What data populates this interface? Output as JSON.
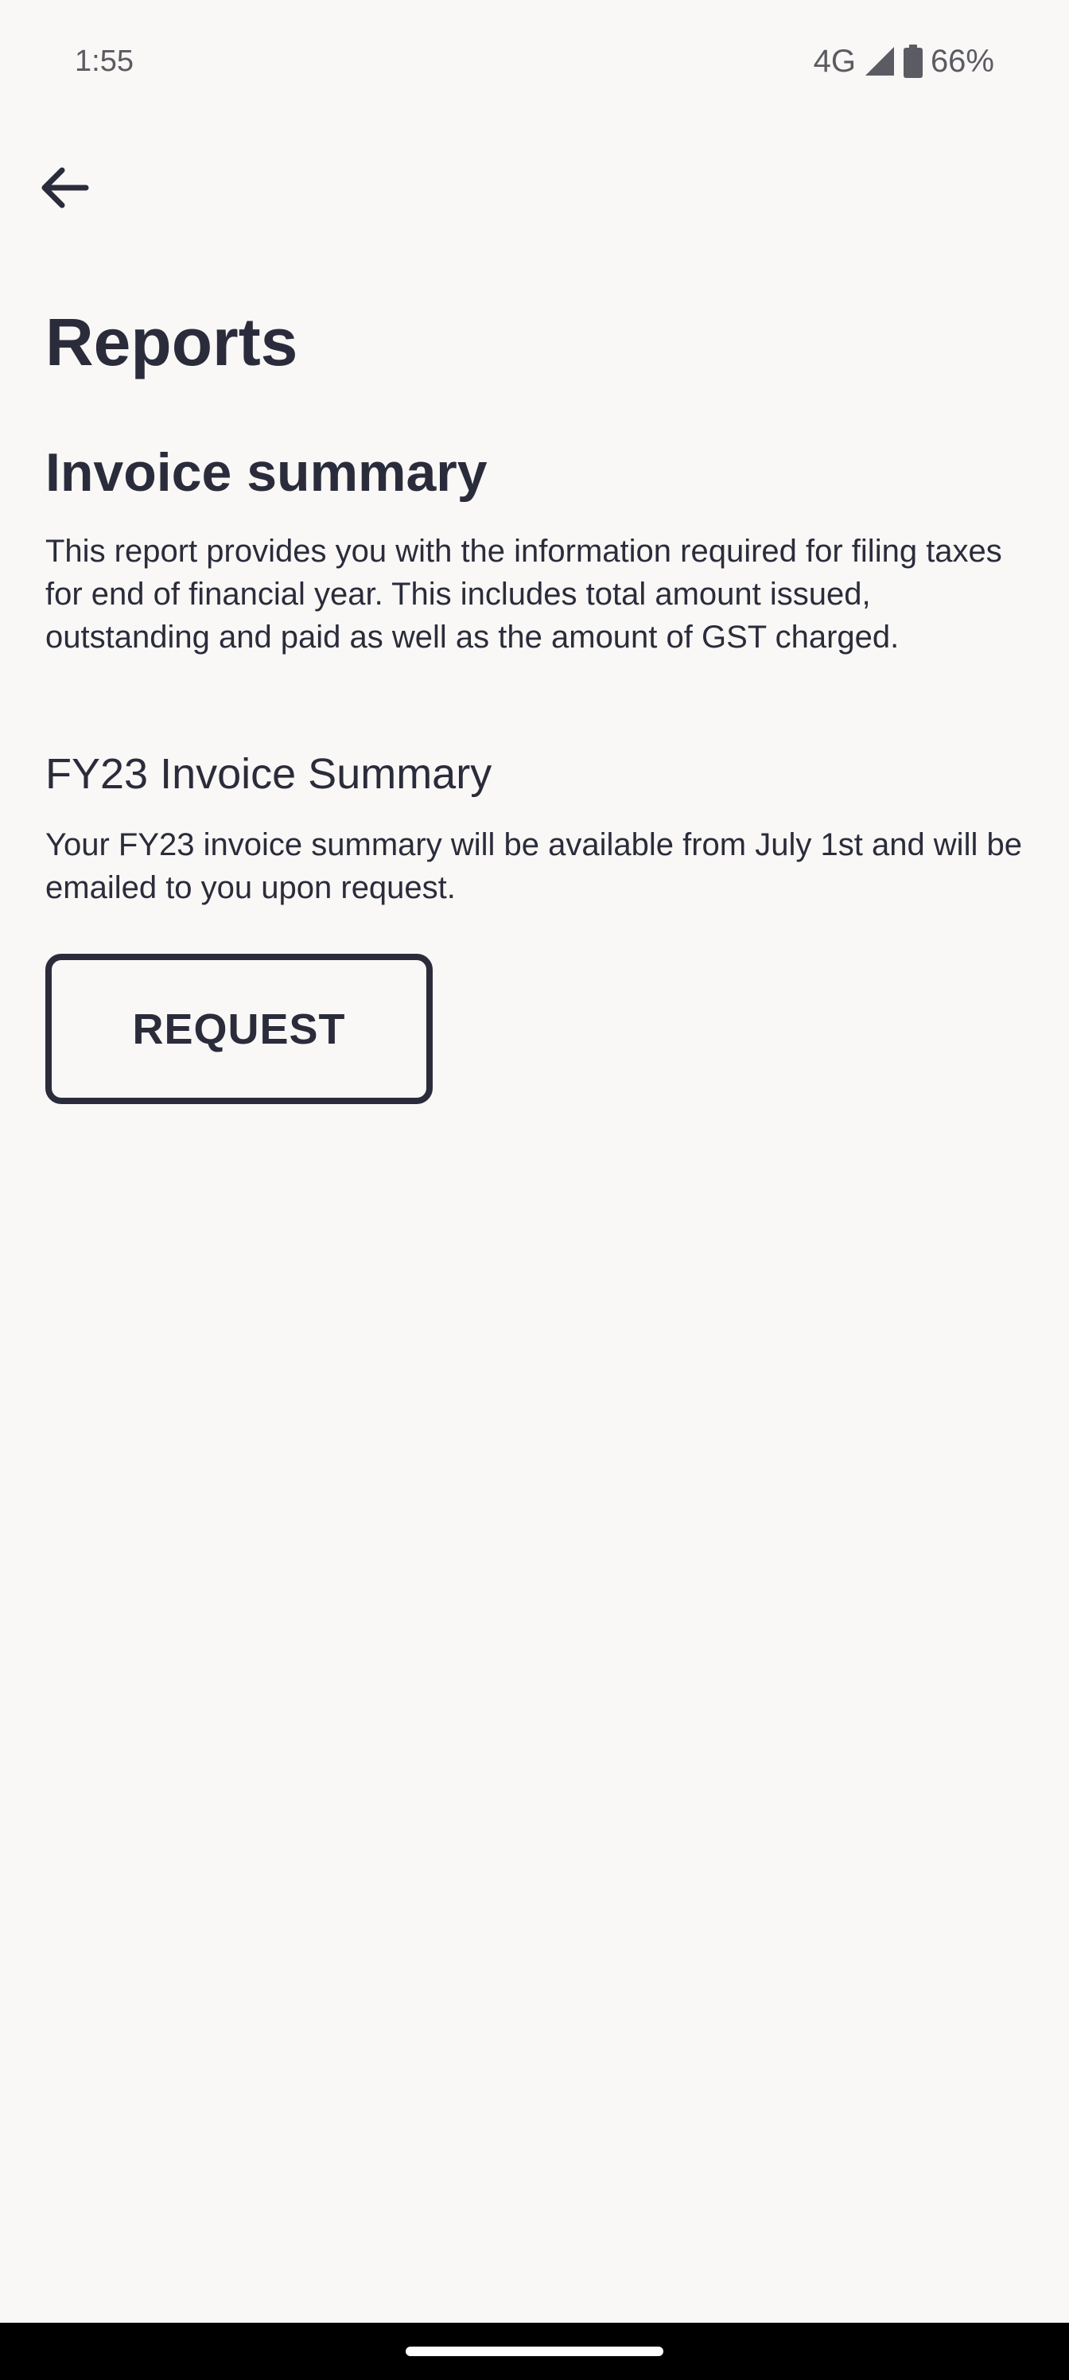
{
  "status_bar": {
    "time": "1:55",
    "network": "4G",
    "battery": "66%",
    "signal_icon": "cellular-signal-icon",
    "battery_icon": "battery-icon"
  },
  "header": {
    "back_icon": "arrow-left-icon",
    "title": "Reports"
  },
  "invoice_summary": {
    "title": "Invoice summary",
    "description": "This report provides you with the information required for filing taxes for end of financial year. This includes total amount issued, outstanding and paid as well as the amount of GST charged."
  },
  "fy_summary": {
    "title": "FY23 Invoice Summary",
    "description": "Your FY23 invoice summary will be available from July 1st and will be emailed to you upon request.",
    "button_label": "REQUEST"
  },
  "colors": {
    "background": "#f9f8f6",
    "text": "#2b2c3b",
    "status_text": "#5b5b63",
    "nav_bar": "#000000"
  }
}
